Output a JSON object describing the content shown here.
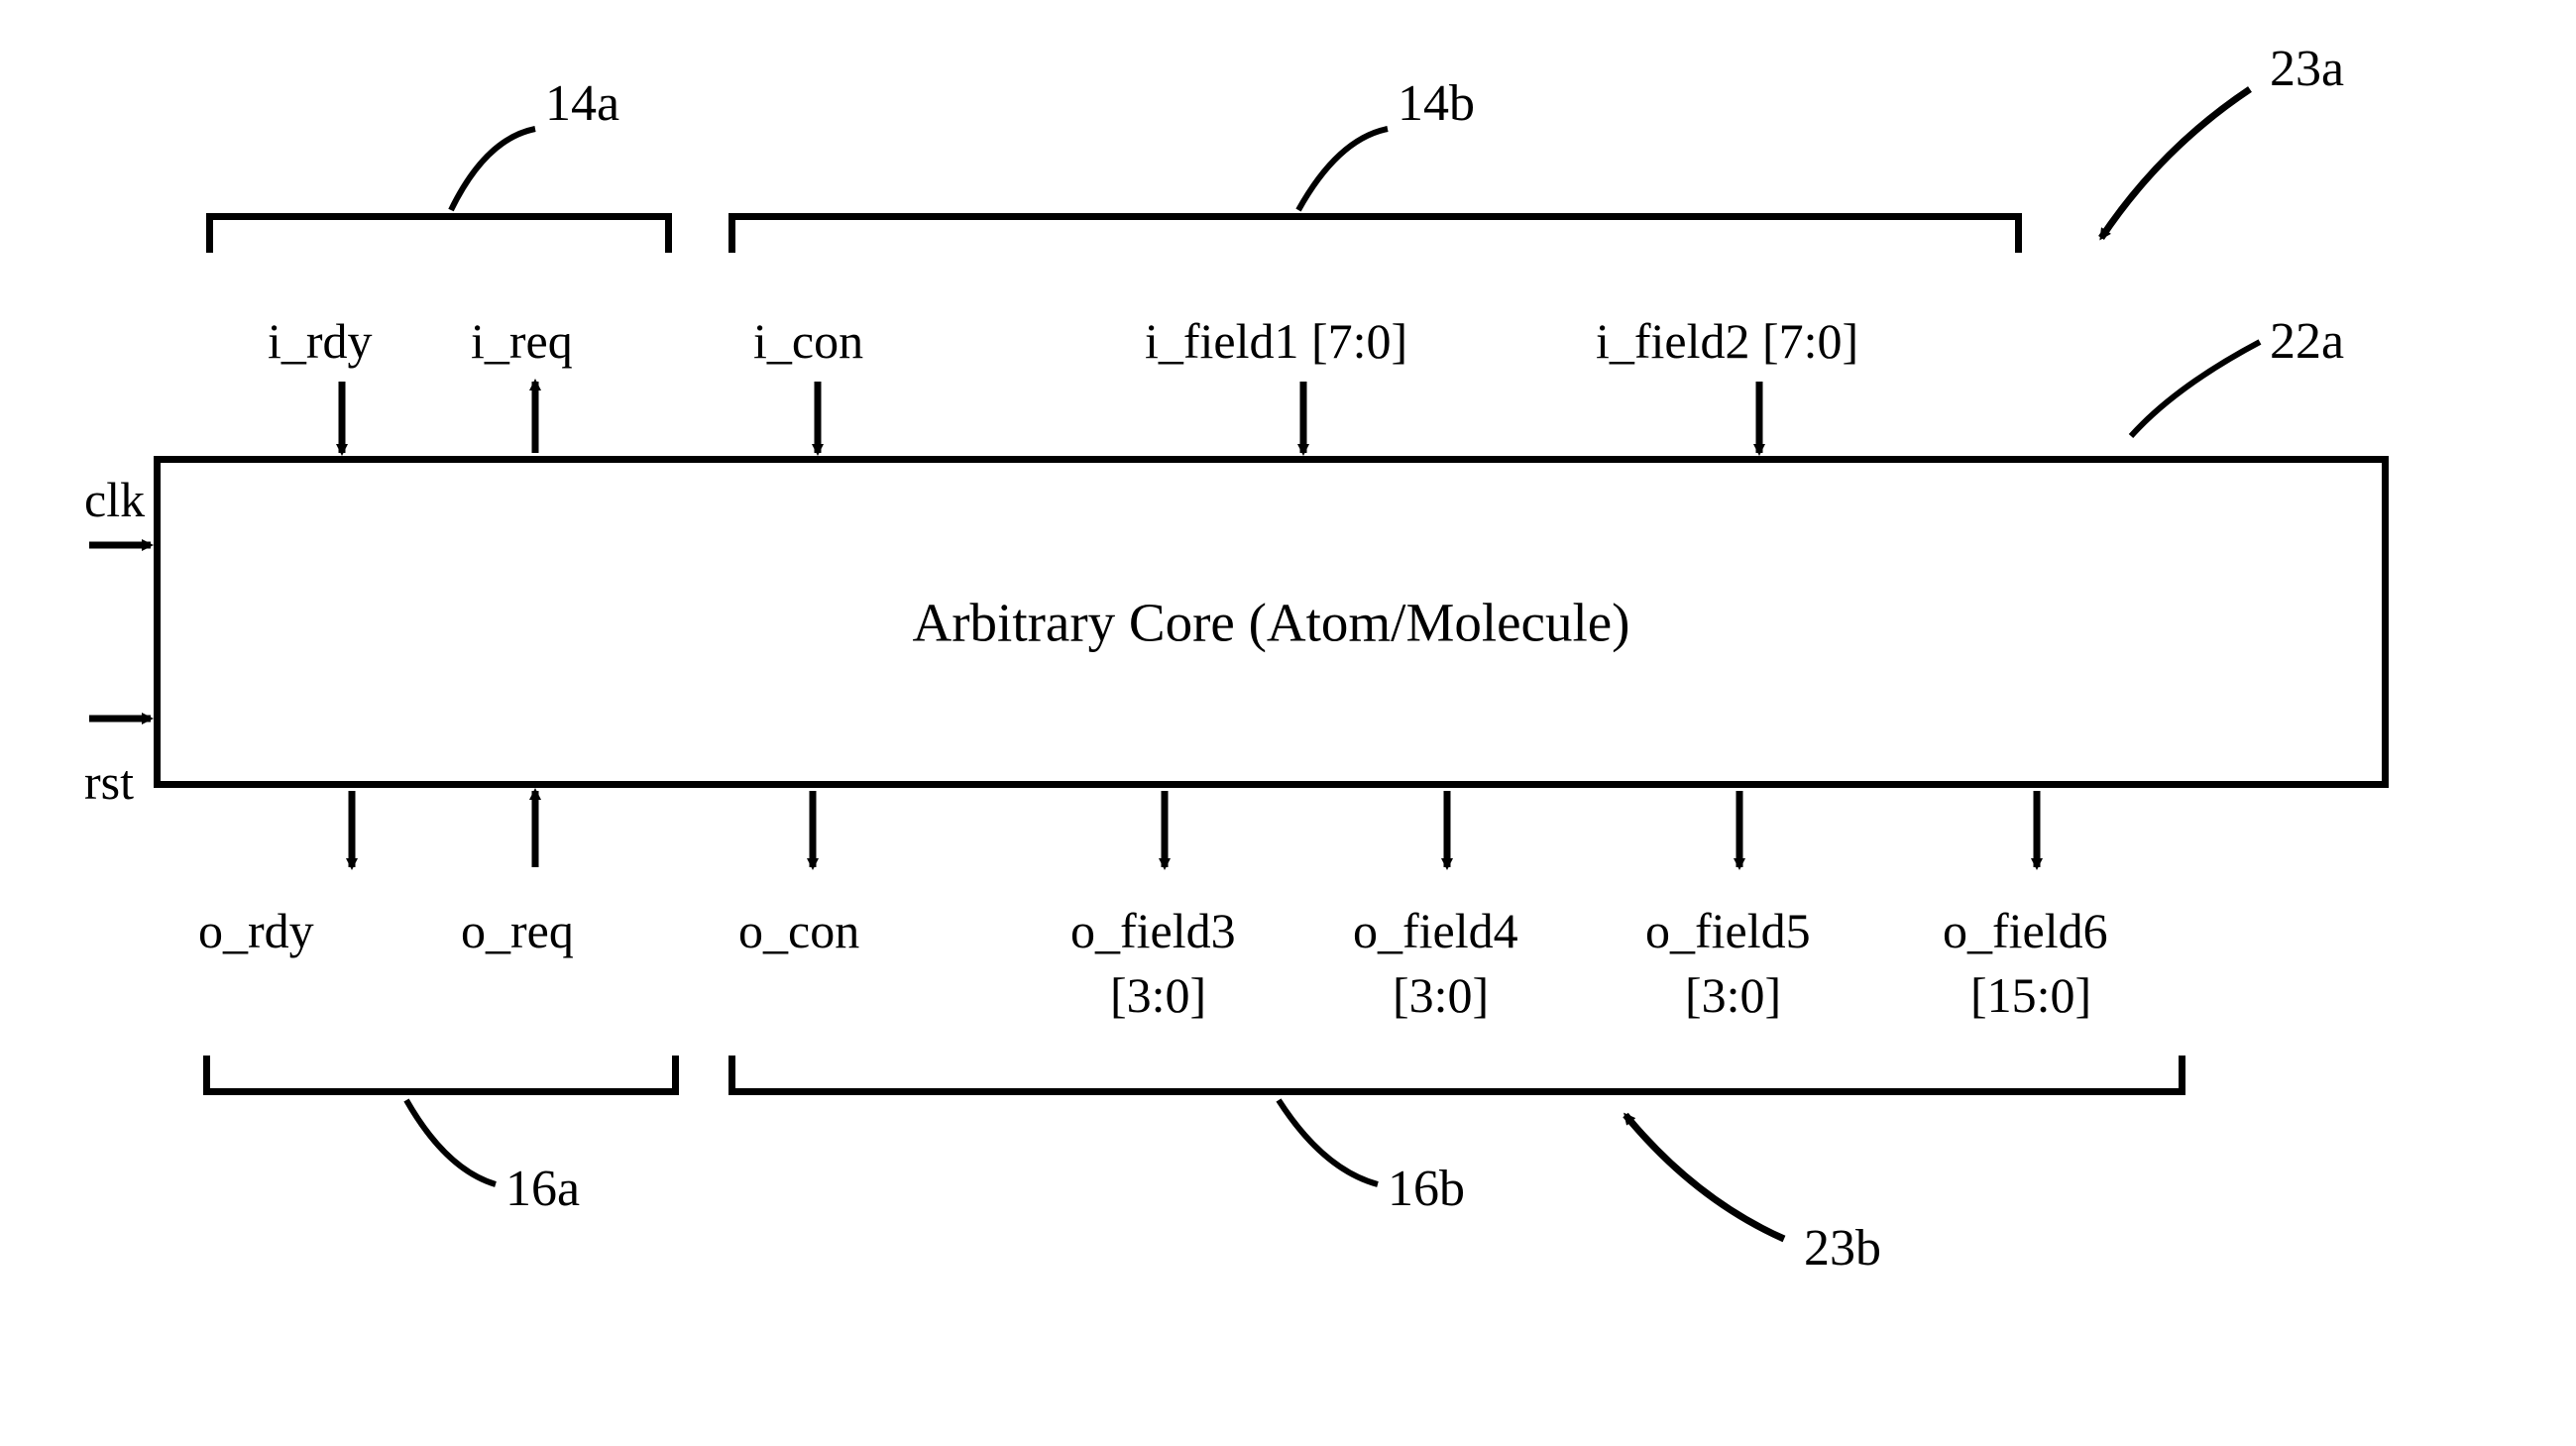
{
  "core": {
    "title": "Arbitrary Core (Atom/Molecule)"
  },
  "side_signals": {
    "clk": "clk",
    "rst": "rst"
  },
  "top_signals": {
    "i_rdy": "i_rdy",
    "i_req": "i_req",
    "i_con": "i_con",
    "i_field1": "i_field1 [7:0]",
    "i_field2": "i_field2 [7:0]"
  },
  "bottom_signals": {
    "o_rdy": "o_rdy",
    "o_req": "o_req",
    "o_con": "o_con",
    "o_field3_name": "o_field3",
    "o_field3_bits": "[3:0]",
    "o_field4_name": "o_field4",
    "o_field4_bits": "[3:0]",
    "o_field5_name": "o_field5",
    "o_field5_bits": "[3:0]",
    "o_field6_name": "o_field6",
    "o_field6_bits": "[15:0]"
  },
  "refs": {
    "r14a": "14a",
    "r14b": "14b",
    "r16a": "16a",
    "r16b": "16b",
    "r22a": "22a",
    "r23a": "23a",
    "r23b": "23b"
  }
}
